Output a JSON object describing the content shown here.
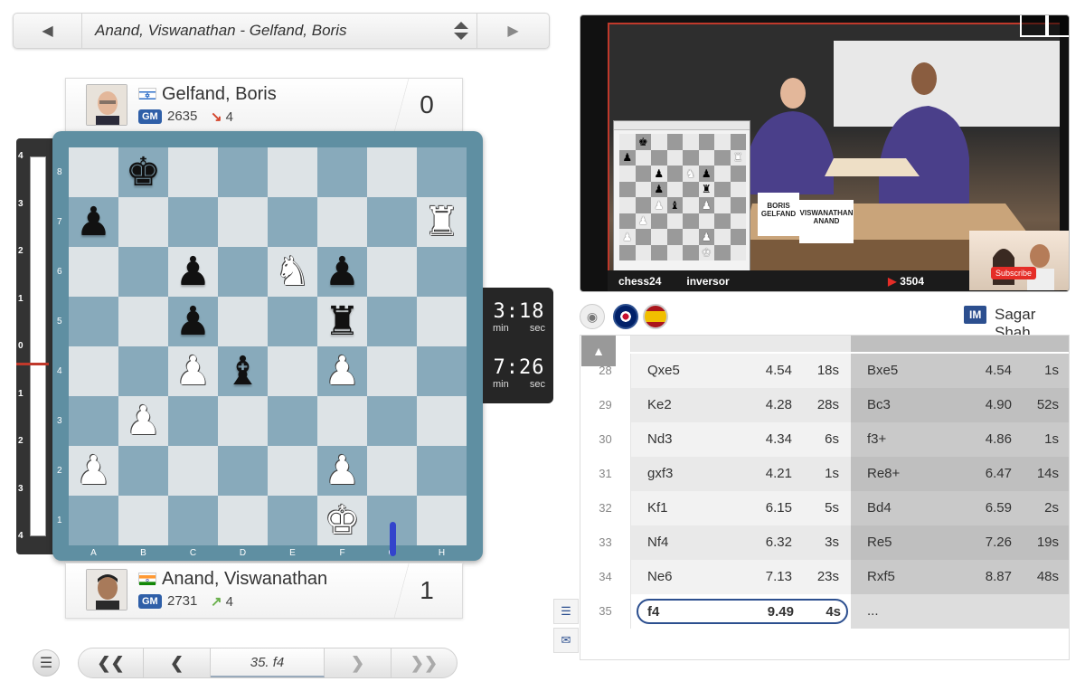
{
  "selector": {
    "game_title": "Anand, Viswanathan - Gelfand, Boris"
  },
  "top_player": {
    "name": "Gelfand, Boris",
    "title": "GM",
    "rating": "2635",
    "rating_change": "4",
    "rating_dir": "down",
    "score": "0",
    "flag": "israel"
  },
  "bottom_player": {
    "name": "Anand, Viswanathan",
    "title": "GM",
    "rating": "2731",
    "rating_change": "4",
    "rating_dir": "up",
    "score": "1",
    "flag": "india"
  },
  "eval_ticks": [
    "4",
    "3",
    "2",
    "1",
    "0",
    "1",
    "2",
    "3",
    "4"
  ],
  "ranks": [
    "8",
    "7",
    "6",
    "5",
    "4",
    "3",
    "2",
    "1"
  ],
  "files": [
    "A",
    "B",
    "C",
    "D",
    "E",
    "F",
    "G",
    "H"
  ],
  "board": [
    [
      "",
      "bk",
      "",
      "",
      "",
      "",
      "",
      ""
    ],
    [
      "bp",
      "",
      "",
      "",
      "",
      "",
      "",
      "wr"
    ],
    [
      "",
      "",
      "bp",
      "",
      "wn",
      "bp",
      "",
      ""
    ],
    [
      "",
      "",
      "bp",
      "",
      "",
      "br",
      "",
      ""
    ],
    [
      "",
      "",
      "wp",
      "bb",
      "",
      "wp",
      "",
      ""
    ],
    [
      "",
      "wp",
      "",
      "",
      "",
      "",
      "",
      ""
    ],
    [
      "wp",
      "",
      "",
      "",
      "",
      "wp",
      "",
      ""
    ],
    [
      "",
      "",
      "",
      "",
      "",
      "wk",
      "",
      ""
    ]
  ],
  "clocks": {
    "top": {
      "time": "3:18",
      "min_label": "min",
      "sec_label": "sec"
    },
    "bottom": {
      "time": "7:26",
      "min_label": "min",
      "sec_label": "sec"
    }
  },
  "nav": {
    "current_move": "35. f4"
  },
  "video": {
    "logo1": "chess24",
    "logo2": "inversor",
    "viewers": "3504",
    "subscribe": "Subscribe",
    "namecard_left": "BORIS GELFAND",
    "namecard_right": "VISWANATHAN ANAND"
  },
  "commentary": {
    "badge": "IM",
    "commentator": "Sagar Shah"
  },
  "moves": [
    {
      "num": "28",
      "w": "Qxe5",
      "we": "4.54",
      "wt": "18s",
      "b": "Bxe5",
      "be": "4.54",
      "bt": "1s"
    },
    {
      "num": "29",
      "w": "Ke2",
      "we": "4.28",
      "wt": "28s",
      "b": "Bc3",
      "be": "4.90",
      "bt": "52s"
    },
    {
      "num": "30",
      "w": "Nd3",
      "we": "4.34",
      "wt": "6s",
      "b": "f3+",
      "be": "4.86",
      "bt": "1s"
    },
    {
      "num": "31",
      "w": "gxf3",
      "we": "4.21",
      "wt": "1s",
      "b": "Re8+",
      "be": "6.47",
      "bt": "14s"
    },
    {
      "num": "32",
      "w": "Kf1",
      "we": "6.15",
      "wt": "5s",
      "b": "Bd4",
      "be": "6.59",
      "bt": "2s"
    },
    {
      "num": "33",
      "w": "Nf4",
      "we": "6.32",
      "wt": "3s",
      "b": "Re5",
      "be": "7.26",
      "bt": "19s"
    },
    {
      "num": "34",
      "w": "Ne6",
      "we": "7.13",
      "wt": "23s",
      "b": "Rxf5",
      "be": "8.87",
      "bt": "48s"
    },
    {
      "num": "35",
      "w": "f4",
      "we": "9.49",
      "wt": "4s",
      "b": "...",
      "be": "",
      "bt": ""
    }
  ]
}
